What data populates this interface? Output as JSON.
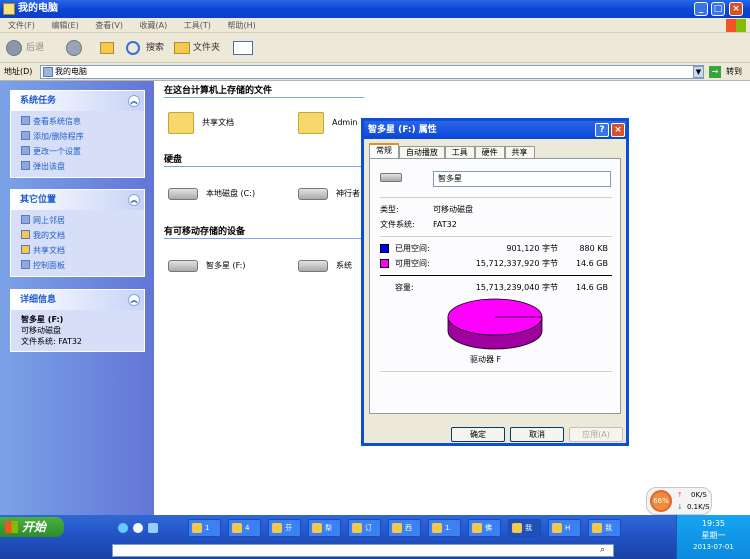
{
  "window": {
    "title": "我的电脑"
  },
  "menu": [
    "文件(F)",
    "编辑(E)",
    "查看(V)",
    "收藏(A)",
    "工具(T)",
    "帮助(H)"
  ],
  "toolbar": {
    "back": "后退",
    "search": "搜索",
    "folders": "文件夹"
  },
  "address": {
    "label": "地址(D)",
    "value": "我的电脑",
    "go": "转到"
  },
  "sidebar": {
    "system_tasks": {
      "title": "系统任务",
      "items": [
        "查看系统信息",
        "添加/删除程序",
        "更改一个设置",
        "弹出该盘"
      ]
    },
    "other_places": {
      "title": "其它位置",
      "items": [
        "网上邻居",
        "我的文档",
        "共享文档",
        "控制面板"
      ]
    },
    "details": {
      "title": "详细信息",
      "name": "智多星 (F:)",
      "type": "可移动磁盘",
      "fs": "文件系统: FAT32"
    }
  },
  "main": {
    "stored_files": {
      "header": "在这台计算机上存储的文件",
      "items": [
        "共享文档",
        "Administrator 的文档"
      ]
    },
    "hard_disks": {
      "header": "硬盘",
      "items": [
        "本地磁盘 (C:)",
        "神行者"
      ]
    },
    "removable": {
      "header": "有可移动存储的设备",
      "items": [
        "智多星 (F:)",
        "系统"
      ]
    }
  },
  "dialog": {
    "title": "智多星 (F:) 属性",
    "tabs": [
      "常规",
      "自动播放",
      "工具",
      "硬件",
      "共享"
    ],
    "name_value": "智多星",
    "type_label": "类型:",
    "type_value": "可移动磁盘",
    "fs_label": "文件系统:",
    "fs_value": "FAT32",
    "used_label": "已用空间:",
    "used_bytes": "901,120 字节",
    "used_size": "880 KB",
    "free_label": "可用空间:",
    "free_bytes": "15,712,337,920 字节",
    "free_size": "14.6 GB",
    "cap_label": "容量:",
    "cap_bytes": "15,713,239,040 字节",
    "cap_size": "14.6 GB",
    "drive_label": "驱动器 F",
    "ok": "确定",
    "cancel": "取消",
    "apply": "应用(A)",
    "used_color": "#0000ff",
    "free_color": "#ff00ff"
  },
  "floater": {
    "percent": "66%",
    "up": "0K/S",
    "down": "0.1K/S"
  },
  "taskbar": {
    "start": "开始",
    "tasks": [
      "1",
      "4",
      "芬",
      "梨",
      "订",
      "西",
      "1.",
      "佛",
      "我",
      "H",
      "我"
    ],
    "clock_time": "19:35",
    "clock_day": "星期一",
    "clock_date": "2013-07-01"
  }
}
